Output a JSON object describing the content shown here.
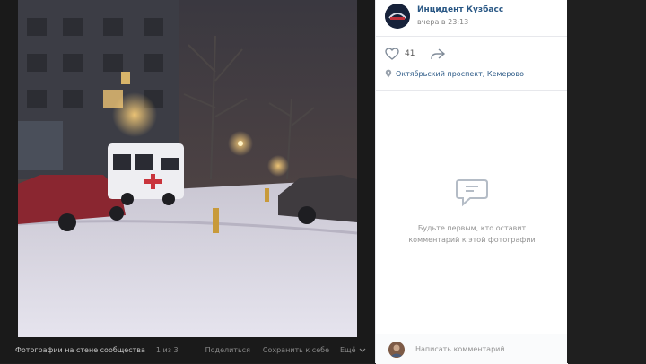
{
  "post": {
    "group_name": "Инцидент Кузбасс",
    "time": "вчера в 23:13",
    "likes": "41",
    "location": "Октябрьский проспект, Кемерово"
  },
  "comments": {
    "empty_line1": "Будьте первым, кто оставит",
    "empty_line2": "комментарий к этой фотографии",
    "input_placeholder": "Написать комментарий..."
  },
  "photo_bar": {
    "album": "Фотографии на стене сообщества",
    "count": "1 из 3",
    "share": "Поделиться",
    "save": "Сохранить к себе",
    "more": "Ещё"
  },
  "icons": [
    "heart-icon",
    "share-arrow-icon",
    "location-pin-icon",
    "comment-bubble-icon",
    "chevron-down-icon"
  ]
}
